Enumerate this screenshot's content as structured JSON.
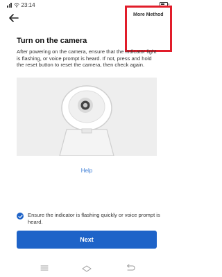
{
  "status_bar": {
    "time": "23:14",
    "battery_level": 0.6,
    "icons": [
      "signal-icon",
      "wifi-icon",
      "battery-icon"
    ]
  },
  "header": {
    "back_icon": "back-arrow-icon",
    "more_method_label": "More Method"
  },
  "content": {
    "title": "Turn on the camera",
    "description": "After powering on the camera, ensure that the indicator light is flashing, or voice prompt is heard. If not, press and hold the reset button to reset the camera, then check again.",
    "illustration_icon": "camera-illustration-icon",
    "help_label": "Help"
  },
  "confirm": {
    "checked": true,
    "label": "Ensure the indicator is flashing quickly or voice prompt is heard."
  },
  "actions": {
    "next_label": "Next"
  },
  "navigation": {
    "icons": [
      "menu-icon",
      "home-icon",
      "back-icon"
    ]
  },
  "colors": {
    "accent": "#1e63c8",
    "link": "#3a7bd5",
    "highlight": "#e11d2a",
    "illustration_bg": "#eeeeee"
  }
}
